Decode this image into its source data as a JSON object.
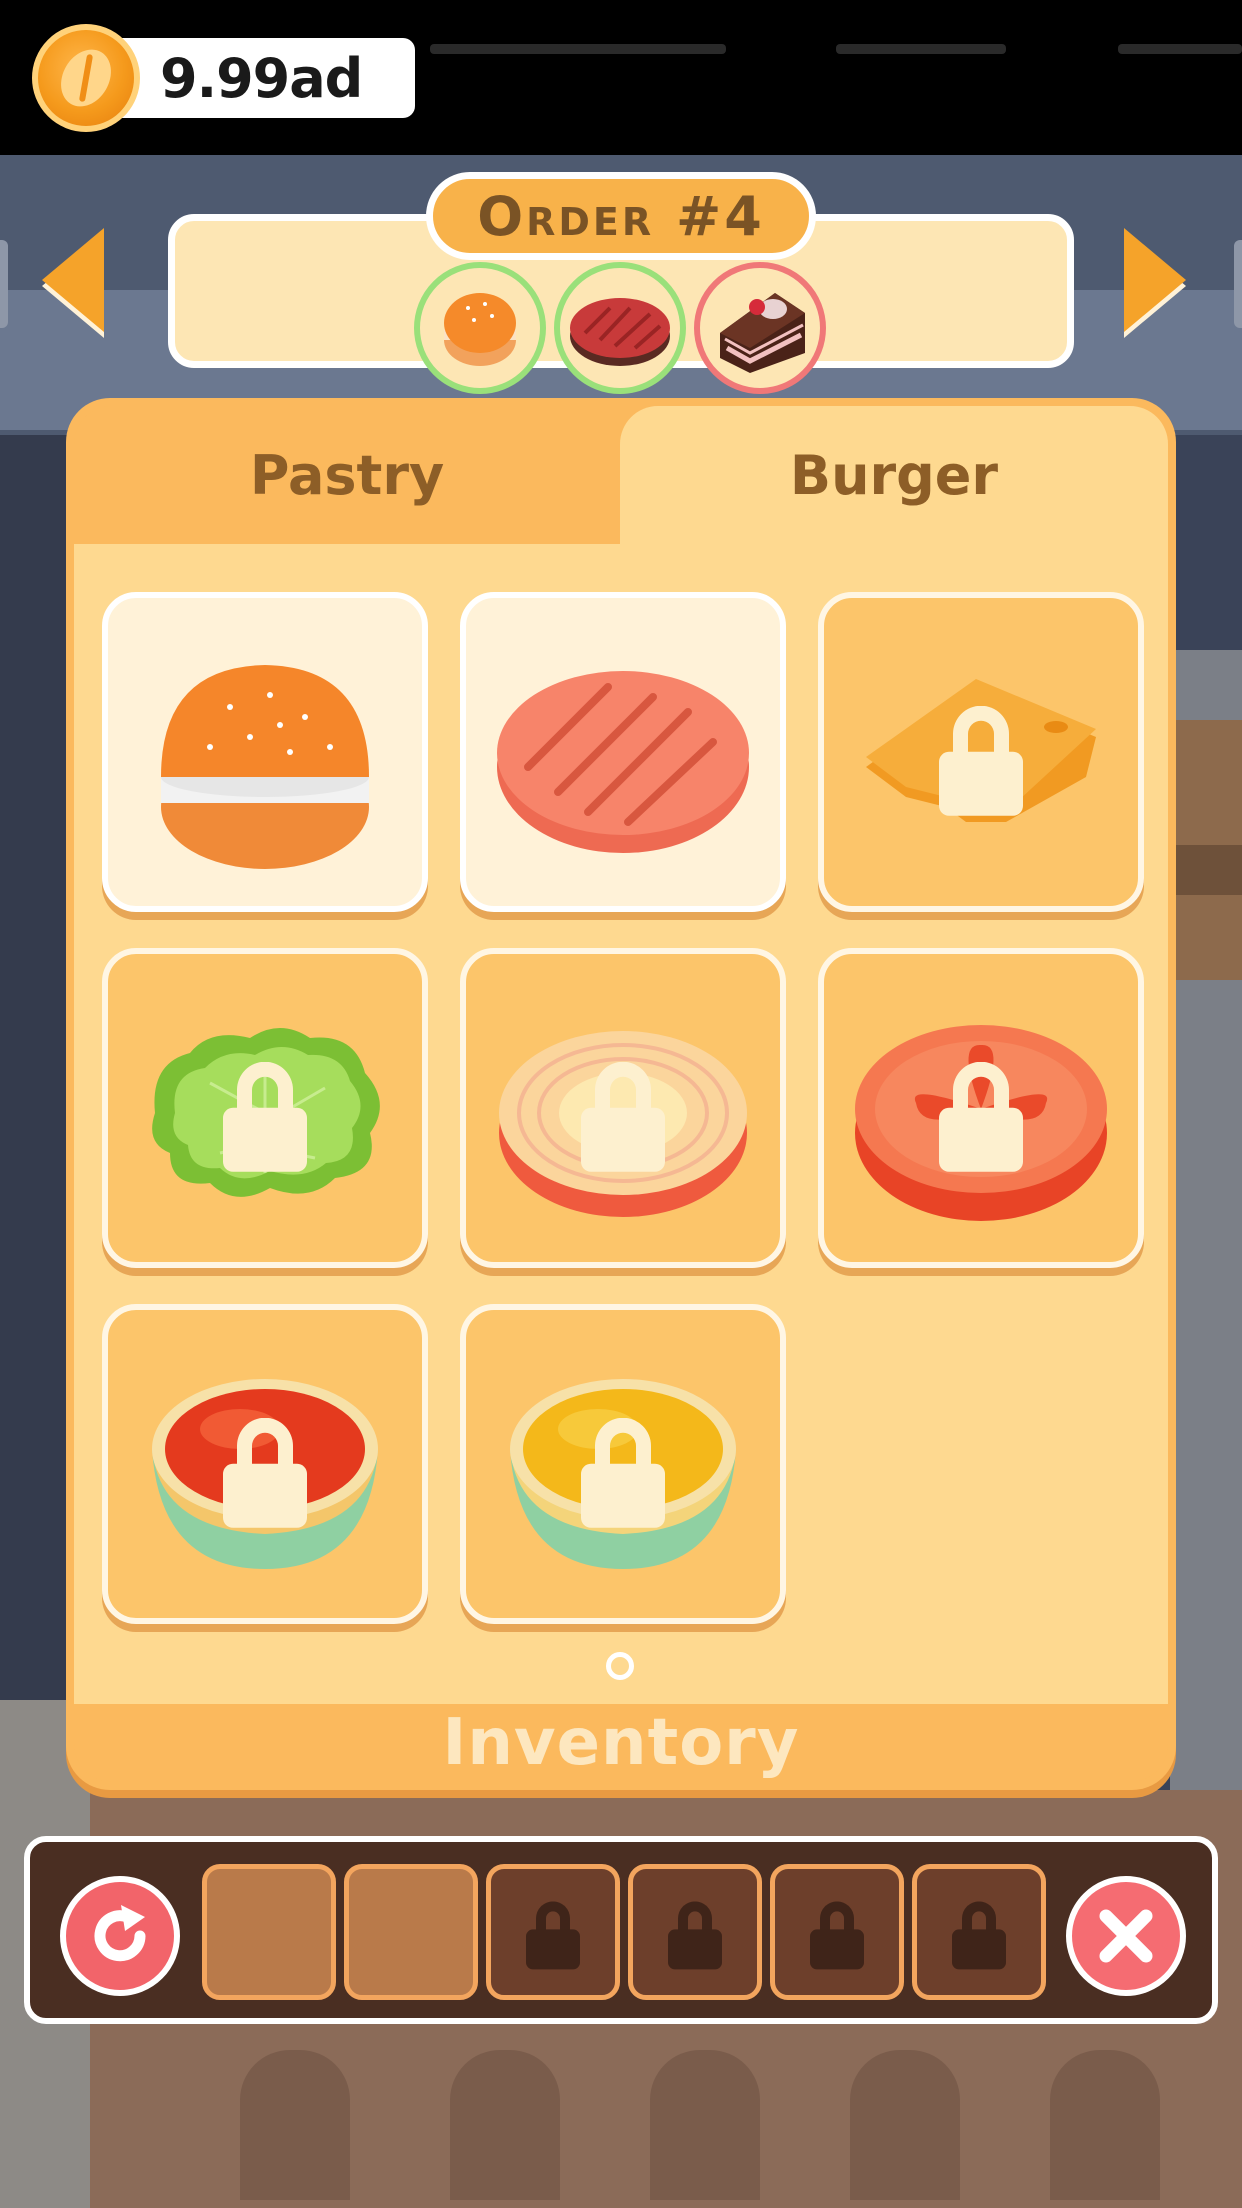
{
  "hud": {
    "currency_value": "9.99ad",
    "currency_icon": "coffee-bean-coin-icon"
  },
  "order": {
    "title": "Order #4",
    "items": [
      {
        "name": "bun",
        "icon": "burger-bun-icon",
        "status": "done",
        "ring_color": "#9ae07a"
      },
      {
        "name": "patty",
        "icon": "beef-patty-icon",
        "status": "done",
        "ring_color": "#9ae07a"
      },
      {
        "name": "cake",
        "icon": "chocolate-cake-icon",
        "status": "pending",
        "ring_color": "#f07878"
      }
    ]
  },
  "panel": {
    "tabs": [
      {
        "label": "Pastry",
        "active": false
      },
      {
        "label": "Burger",
        "active": true
      }
    ],
    "ingredients": [
      {
        "name": "bun",
        "icon": "burger-bun-icon",
        "locked": false
      },
      {
        "name": "patty",
        "icon": "beef-patty-icon",
        "locked": false
      },
      {
        "name": "cheese",
        "icon": "cheese-slice-icon",
        "locked": true
      },
      {
        "name": "lettuce",
        "icon": "lettuce-leaf-icon",
        "locked": true
      },
      {
        "name": "onion",
        "icon": "onion-ring-icon",
        "locked": true
      },
      {
        "name": "tomato",
        "icon": "tomato-slice-icon",
        "locked": true
      },
      {
        "name": "ketchup",
        "icon": "ketchup-bowl-icon",
        "locked": true
      },
      {
        "name": "mustard",
        "icon": "mustard-bowl-icon",
        "locked": true
      }
    ],
    "page_indicator": {
      "current": 1,
      "total": 1
    },
    "footer_label": "Inventory"
  },
  "tray": {
    "reset_icon": "refresh-icon",
    "close_icon": "close-icon",
    "slots": [
      {
        "locked": false
      },
      {
        "locked": false
      },
      {
        "locked": true
      },
      {
        "locked": true
      },
      {
        "locked": true
      },
      {
        "locked": true
      }
    ]
  },
  "colors": {
    "accent_orange": "#f5a32a",
    "panel_orange": "#fbb95d",
    "panel_cream": "#fed990",
    "button_red": "#f2646a",
    "tray_brown": "#4a2e22"
  }
}
